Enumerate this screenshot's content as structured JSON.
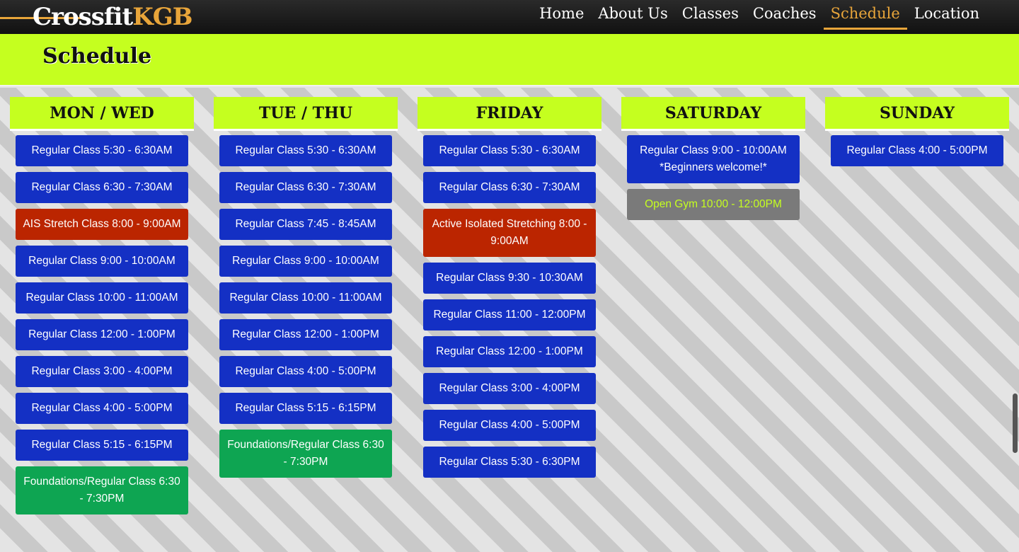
{
  "header": {
    "logo_main": "Crossfit",
    "logo_accent": "KGB",
    "nav": [
      {
        "label": "Home"
      },
      {
        "label": "About Us"
      },
      {
        "label": "Classes"
      },
      {
        "label": "Coaches"
      },
      {
        "label": "Schedule"
      },
      {
        "label": "Location"
      }
    ],
    "active_nav": "Schedule"
  },
  "page": {
    "title": "Schedule"
  },
  "colors": {
    "accent_gold": "#e8a53a",
    "lime": "#c5ff1f",
    "regular": "#1430c4",
    "stretch": "#bb2500",
    "foundations": "#0ea552",
    "open_gym": "#7a7a7a"
  },
  "schedule": [
    {
      "day": "MON / WED",
      "slots": [
        {
          "label": "Regular Class 5:30 - 6:30AM",
          "kind": "regular"
        },
        {
          "label": "Regular Class 6:30 - 7:30AM",
          "kind": "regular"
        },
        {
          "label": "AIS Stretch Class 8:00 - 9:00AM",
          "kind": "stretch"
        },
        {
          "label": "Regular Class 9:00 - 10:00AM",
          "kind": "regular"
        },
        {
          "label": "Regular Class 10:00 - 11:00AM",
          "kind": "regular"
        },
        {
          "label": "Regular Class 12:00 - 1:00PM",
          "kind": "regular"
        },
        {
          "label": "Regular Class 3:00 - 4:00PM",
          "kind": "regular"
        },
        {
          "label": "Regular Class 4:00 - 5:00PM",
          "kind": "regular"
        },
        {
          "label": "Regular Class 5:15 - 6:15PM",
          "kind": "regular"
        },
        {
          "label": "Foundations/Regular Class 6:30 - 7:30PM",
          "kind": "found"
        }
      ]
    },
    {
      "day": "TUE / THU",
      "slots": [
        {
          "label": "Regular Class 5:30 - 6:30AM",
          "kind": "regular"
        },
        {
          "label": "Regular Class 6:30 - 7:30AM",
          "kind": "regular"
        },
        {
          "label": "Regular Class 7:45 - 8:45AM",
          "kind": "regular"
        },
        {
          "label": "Regular Class 9:00 - 10:00AM",
          "kind": "regular"
        },
        {
          "label": "Regular Class 10:00 - 11:00AM",
          "kind": "regular"
        },
        {
          "label": "Regular Class 12:00 - 1:00PM",
          "kind": "regular"
        },
        {
          "label": "Regular Class 4:00 - 5:00PM",
          "kind": "regular"
        },
        {
          "label": "Regular Class 5:15 - 6:15PM",
          "kind": "regular"
        },
        {
          "label": "Foundations/Regular Class 6:30 - 7:30PM",
          "kind": "found"
        }
      ]
    },
    {
      "day": "FRIDAY",
      "slots": [
        {
          "label": "Regular Class 5:30 - 6:30AM",
          "kind": "regular"
        },
        {
          "label": "Regular Class 6:30 - 7:30AM",
          "kind": "regular"
        },
        {
          "label": "Active Isolated Stretching 8:00 - 9:00AM",
          "kind": "stretch"
        },
        {
          "label": "Regular Class 9:30 - 10:30AM",
          "kind": "regular"
        },
        {
          "label": "Regular Class 11:00 - 12:00PM",
          "kind": "regular"
        },
        {
          "label": "Regular Class 12:00 - 1:00PM",
          "kind": "regular"
        },
        {
          "label": "Regular Class 3:00 - 4:00PM",
          "kind": "regular"
        },
        {
          "label": "Regular Class 4:00 - 5:00PM",
          "kind": "regular"
        },
        {
          "label": "Regular Class 5:30 - 6:30PM",
          "kind": "regular"
        }
      ]
    },
    {
      "day": "SATURDAY",
      "slots": [
        {
          "label": "Regular Class 9:00 - 10:00AM *Beginners welcome!*",
          "kind": "regular"
        },
        {
          "label": "Open Gym 10:00 - 12:00PM",
          "kind": "open"
        }
      ]
    },
    {
      "day": "SUNDAY",
      "slots": [
        {
          "label": "Regular Class 4:00 - 5:00PM",
          "kind": "regular"
        }
      ]
    }
  ]
}
